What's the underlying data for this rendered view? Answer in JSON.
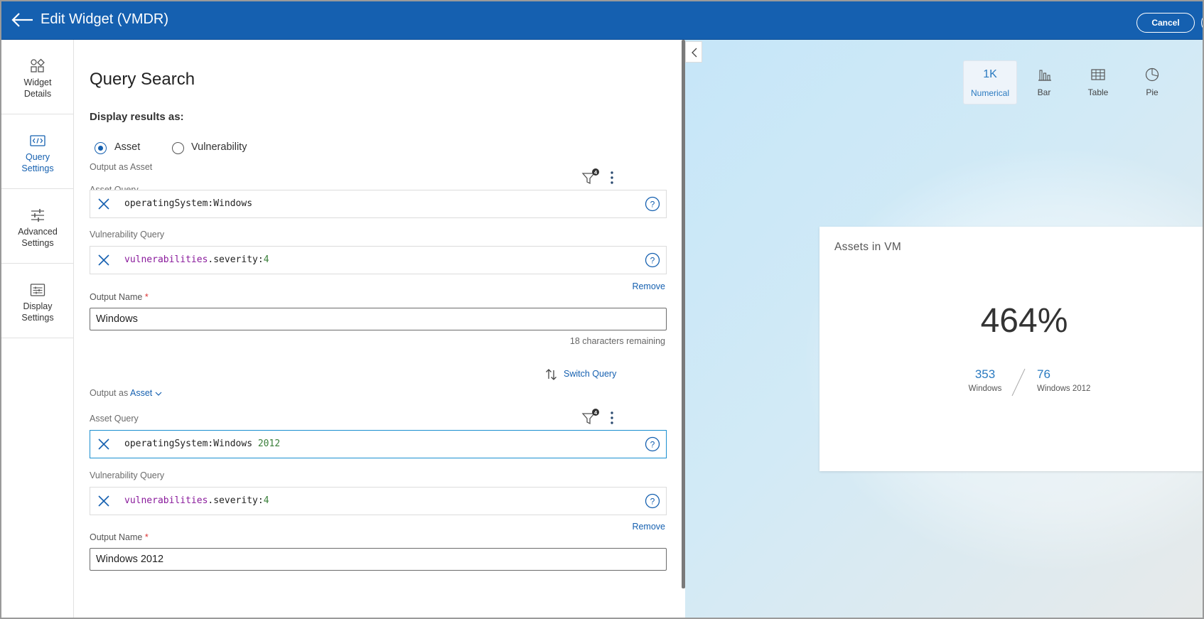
{
  "header": {
    "title": "Edit Widget (VMDR)",
    "cancel_label": "Cancel"
  },
  "sidebar": {
    "items": [
      {
        "label_line1": "Widget",
        "label_line2": "Details",
        "icon": "widget-shapes-icon",
        "active": false
      },
      {
        "label_line1": "Query",
        "label_line2": "Settings",
        "icon": "code-icon",
        "active": true
      },
      {
        "label_line1": "Advanced",
        "label_line2": "Settings",
        "icon": "sliders-icon",
        "active": false
      },
      {
        "label_line1": "Display",
        "label_line2": "Settings",
        "icon": "display-settings-icon",
        "active": false
      }
    ]
  },
  "form": {
    "title": "Query Search",
    "display_results_label": "Display results as:",
    "radio_options": [
      {
        "label": "Asset",
        "selected": true
      },
      {
        "label": "Vulnerability",
        "selected": false
      }
    ],
    "blocks": [
      {
        "output_as_prefix": "Output as",
        "output_as_value": "Asset",
        "asset_query_label": "Asset Query",
        "filter_count": "4",
        "asset_query": {
          "key": "operatingSystem",
          "sep": ":",
          "value": "Windows",
          "extra": ""
        },
        "vuln_query_label": "Vulnerability Query",
        "vuln_query": {
          "key": "vulnerabilities",
          "dot": ".",
          "field": "severity",
          "sep": ":",
          "value": "4"
        },
        "remove_label": "Remove",
        "output_name_label": "Output Name",
        "required_mark": "*",
        "output_name_value": "Windows",
        "chars_remaining": "18 characters remaining"
      },
      {
        "output_as_prefix": "Output as",
        "output_as_value": "Asset",
        "asset_query_label": "Asset Query",
        "filter_count": "4",
        "asset_query": {
          "key": "operatingSystem",
          "sep": ":",
          "value": "Windows",
          "extra": "2012"
        },
        "vuln_query_label": "Vulnerability Query",
        "vuln_query": {
          "key": "vulnerabilities",
          "dot": ".",
          "field": "severity",
          "sep": ":",
          "value": "4"
        },
        "remove_label": "Remove",
        "output_name_label": "Output Name",
        "required_mark": "*",
        "output_name_value": "Windows 2012"
      }
    ],
    "switch_query_label": "Switch Query"
  },
  "preview": {
    "chart_types": [
      {
        "icon_text": "1K",
        "label": "Numerical",
        "active": true
      },
      {
        "icon_text": "",
        "label": "Bar",
        "icon": "bar-chart-icon",
        "active": false
      },
      {
        "icon_text": "",
        "label": "Table",
        "icon": "table-icon",
        "active": false
      },
      {
        "icon_text": "",
        "label": "Pie",
        "icon": "pie-chart-icon",
        "active": false
      }
    ],
    "card": {
      "title": "Assets in VM",
      "big_value": "464%",
      "numerator": "353",
      "numerator_label": "Windows",
      "denominator": "76",
      "denominator_label": "Windows 2012"
    }
  },
  "colors": {
    "brand_blue": "#1560b0",
    "link_blue": "#2a7ac0",
    "query_purple": "#8a1b9c",
    "query_green": "#3a7f3a"
  }
}
